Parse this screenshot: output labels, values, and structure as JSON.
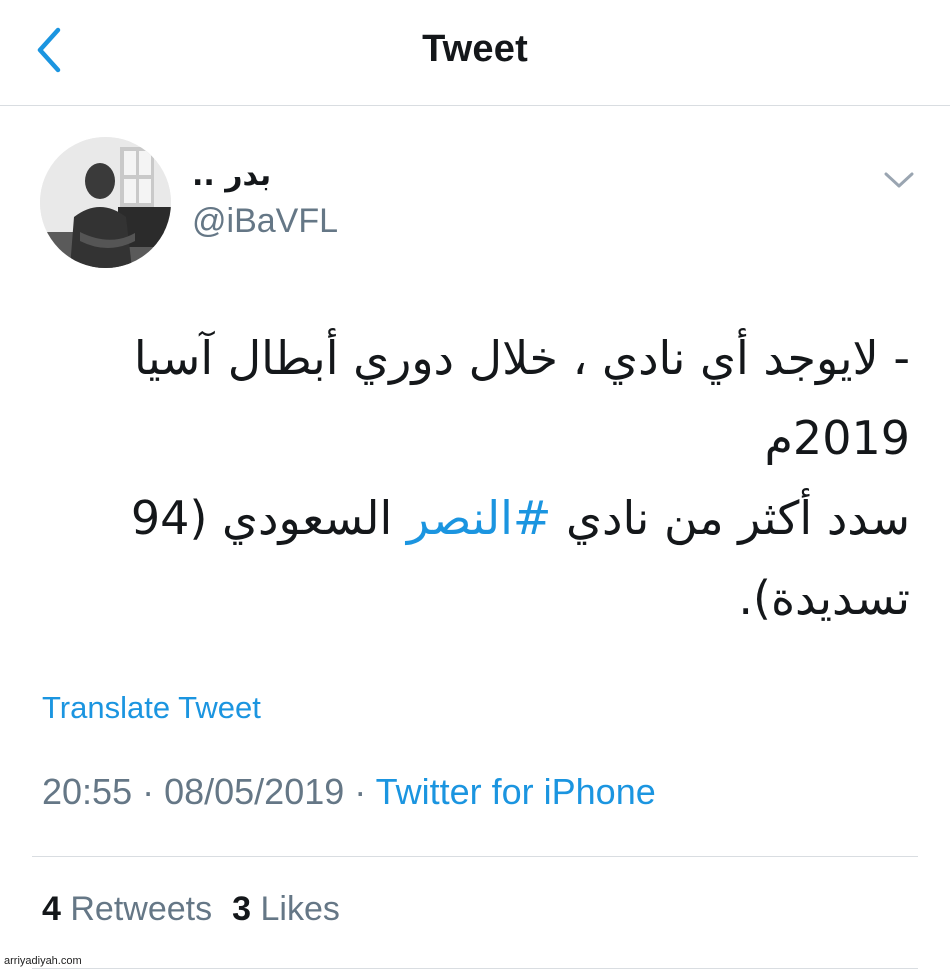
{
  "header": {
    "title": "Tweet"
  },
  "author": {
    "display_name": "بدر ..",
    "handle": "@iBaVFL"
  },
  "tweet": {
    "lines": [
      {
        "text": "- لايوجد أي نادي ، خلال دوري أبطال آسيا"
      },
      {
        "text": "2019م"
      },
      {
        "before": "سدد أكثر من نادي ",
        "hashtag": "#النصر",
        "after": " السعودي (94"
      },
      {
        "text": "تسديدة)."
      }
    ],
    "translate_label": "Translate Tweet"
  },
  "meta": {
    "time": "20:55",
    "separator": " · ",
    "date": "08/05/2019",
    "source": "Twitter for iPhone"
  },
  "stats": {
    "retweets_count": "4",
    "retweets_label": "Retweets",
    "likes_count": "3",
    "likes_label": "Likes"
  },
  "watermark": "arriyadiyah.com",
  "colors": {
    "link": "#1b95e0",
    "muted": "#657786",
    "text": "#14171a",
    "divider": "#d9dde1"
  },
  "icons": {
    "back": "chevron-left-icon",
    "menu": "chevron-down-icon"
  }
}
